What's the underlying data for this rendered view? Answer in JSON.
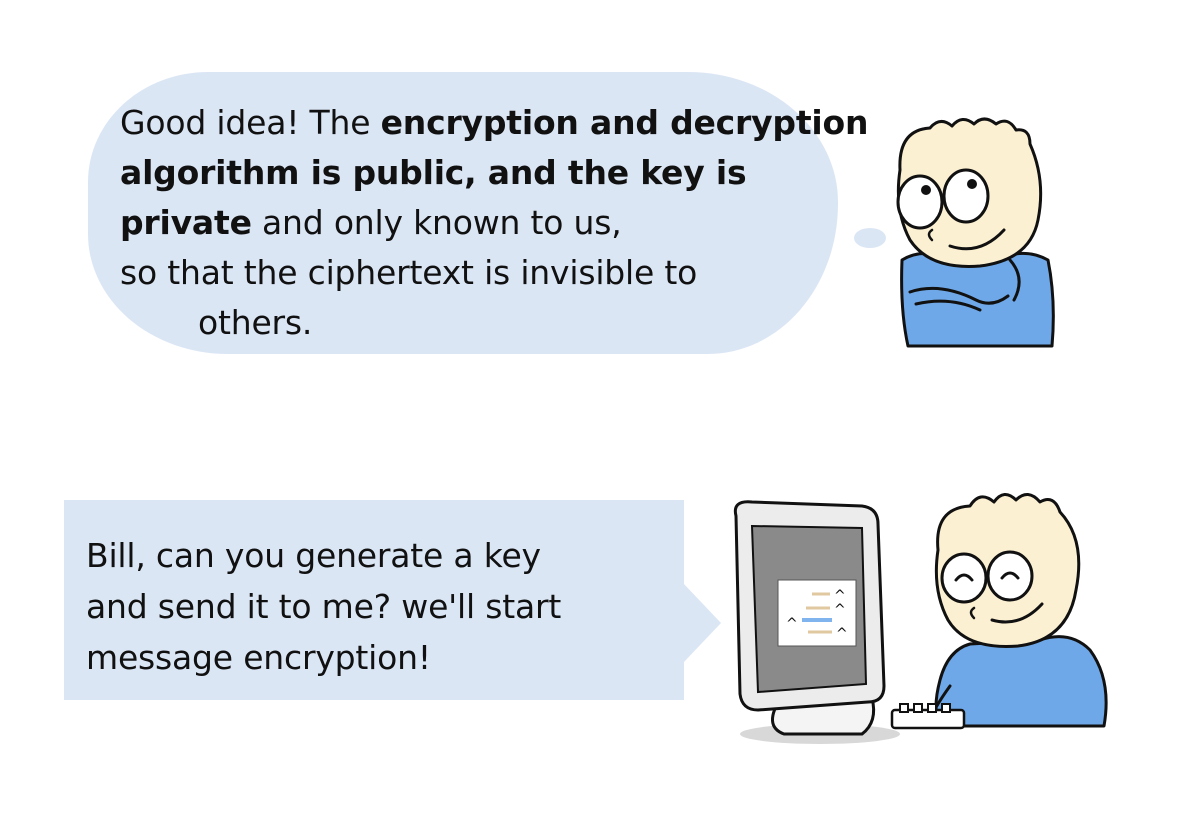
{
  "top_panel": {
    "bubble": {
      "intro": "Good idea! The ",
      "bold": "encryption and decryption algorithm is public, and the key is private",
      "middle": " and only known to us,",
      "line4": "so that the ciphertext is invisible to",
      "line5": "others."
    }
  },
  "bottom_panel": {
    "bubble": {
      "line1": "Bill, can you generate a key",
      "line2": "and send it to me? we'll start",
      "line3": "message encryption!"
    }
  },
  "colors": {
    "bubble_fill": "#dbe6f5",
    "skin": "#fcf0d2",
    "shirt": "#6fa8e8",
    "monitor_screen": "#8a8a8a",
    "outline": "#111111"
  },
  "icons": [
    "thinking-boy-illustration",
    "computer-monitor-icon",
    "keyboard-icon",
    "typing-boy-illustration"
  ]
}
